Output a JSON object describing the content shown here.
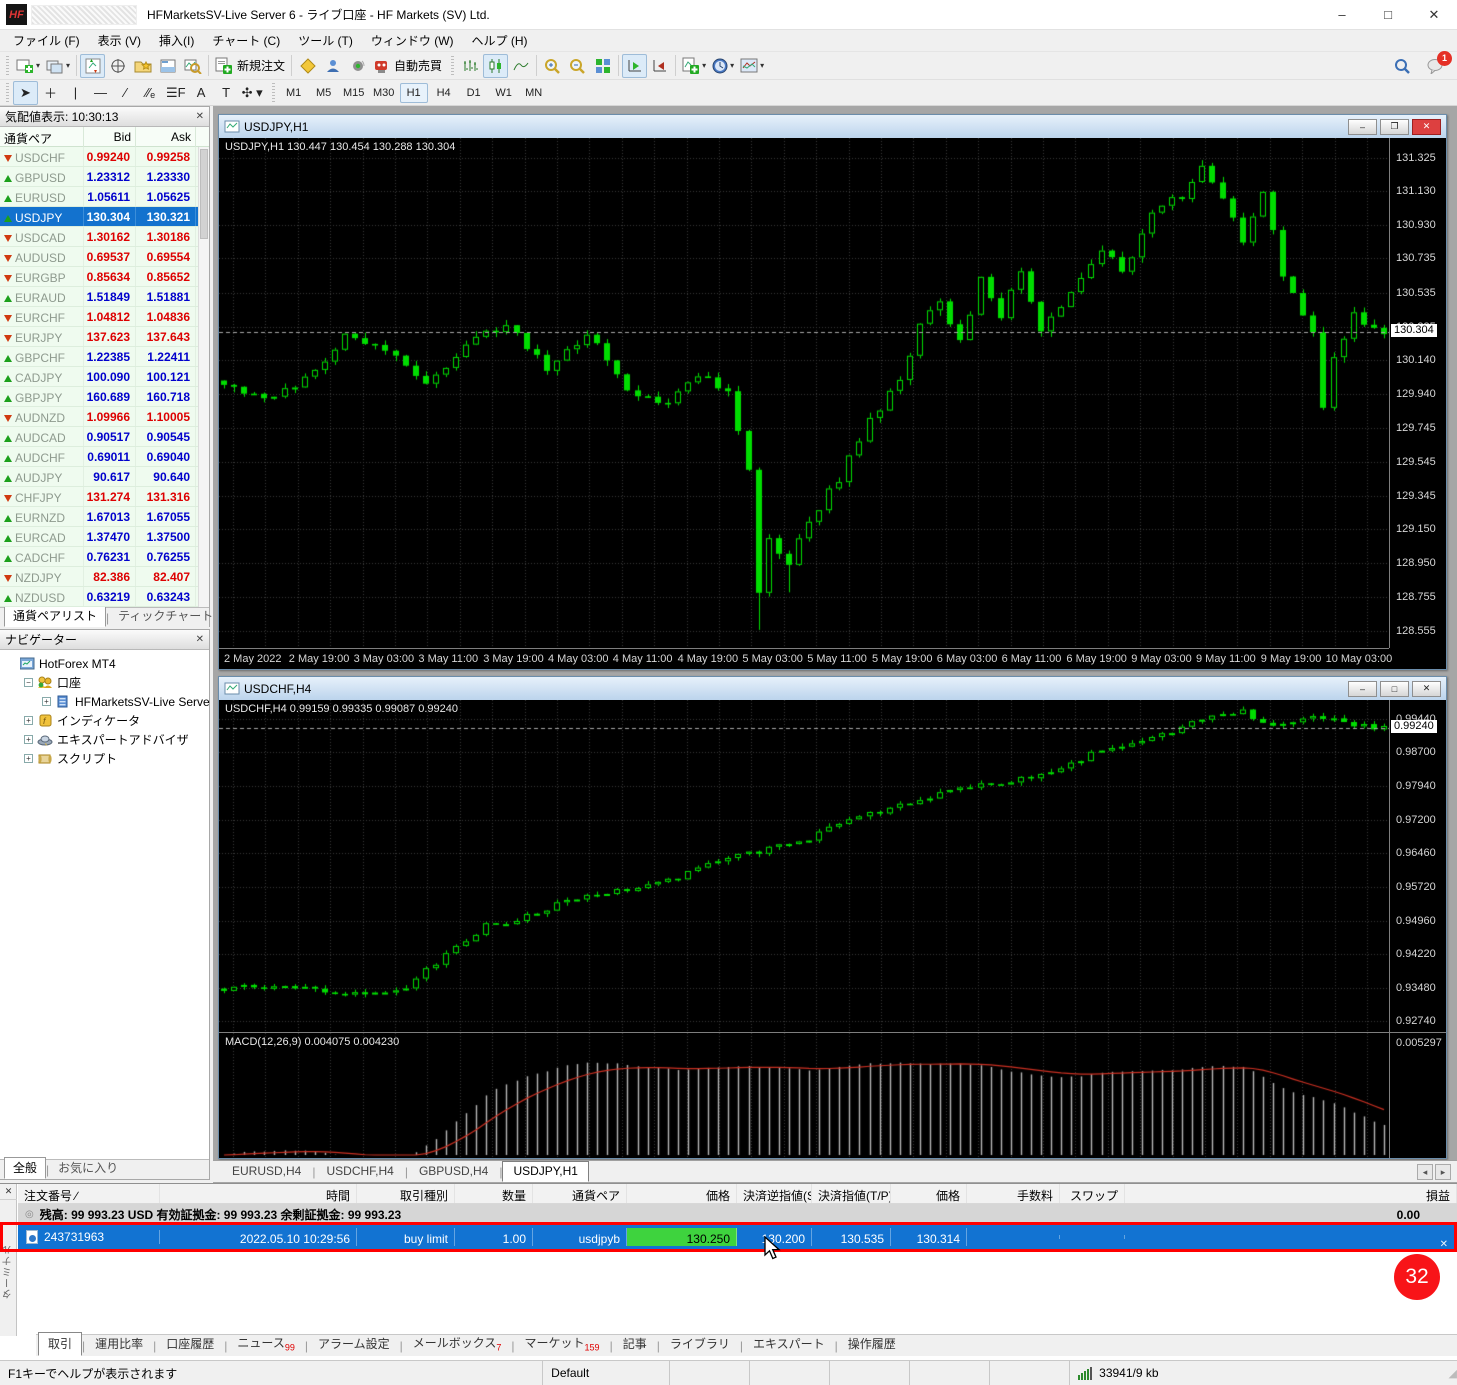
{
  "window": {
    "title": "HFMarketsSV-Live Server 6 - ライブ口座 - HF Markets (SV) Ltd.",
    "logo": "HF",
    "controls": {
      "minimize": "–",
      "maximize": "□",
      "close": "✕"
    }
  },
  "menu": [
    "ファイル (F)",
    "表示 (V)",
    "挿入(I)",
    "チャート (C)",
    "ツール (T)",
    "ウィンドウ (W)",
    "ヘルプ (H)"
  ],
  "toolbar": {
    "new_order_label": "新規注文",
    "auto_trading_label": "自動売買",
    "notification_count": "1",
    "tools": [
      {
        "name": "cursor-tool",
        "glyph": "➤",
        "pressed": true
      },
      {
        "name": "crosshair-tool",
        "glyph": "＋",
        "pressed": false
      },
      {
        "name": "vertical-line-tool",
        "glyph": "|",
        "pressed": false
      },
      {
        "name": "horizontal-line-tool",
        "glyph": "—",
        "pressed": false
      },
      {
        "name": "trendline-tool",
        "glyph": "∕",
        "pressed": false
      },
      {
        "name": "channel-tool",
        "glyph": "∕∕ₑ",
        "pressed": false
      },
      {
        "name": "fibonacci-tool",
        "glyph": "☰F",
        "pressed": false
      },
      {
        "name": "text-tool",
        "glyph": "A",
        "pressed": false
      },
      {
        "name": "text-label-tool",
        "glyph": "T",
        "pressed": false
      },
      {
        "name": "arrows-tool",
        "glyph": "✣ ▾",
        "pressed": false
      }
    ],
    "timeframes": [
      "M1",
      "M5",
      "M15",
      "M30",
      "H1",
      "H4",
      "D1",
      "W1",
      "MN"
    ],
    "active_timeframe": "H1"
  },
  "market_watch": {
    "title": "気配値表示: 10:30:13",
    "columns": [
      "通貨ペア",
      "Bid",
      "Ask"
    ],
    "selected_symbol": "USDJPY",
    "rows": [
      {
        "symbol": "USDCHF",
        "bid": "0.99240",
        "ask": "0.99258",
        "trend": "down"
      },
      {
        "symbol": "GBPUSD",
        "bid": "1.23312",
        "ask": "1.23330",
        "trend": "up"
      },
      {
        "symbol": "EURUSD",
        "bid": "1.05611",
        "ask": "1.05625",
        "trend": "up"
      },
      {
        "symbol": "USDJPY",
        "bid": "130.304",
        "ask": "130.321",
        "trend": "up"
      },
      {
        "symbol": "USDCAD",
        "bid": "1.30162",
        "ask": "1.30186",
        "trend": "down"
      },
      {
        "symbol": "AUDUSD",
        "bid": "0.69537",
        "ask": "0.69554",
        "trend": "down"
      },
      {
        "symbol": "EURGBP",
        "bid": "0.85634",
        "ask": "0.85652",
        "trend": "down"
      },
      {
        "symbol": "EURAUD",
        "bid": "1.51849",
        "ask": "1.51881",
        "trend": "up"
      },
      {
        "symbol": "EURCHF",
        "bid": "1.04812",
        "ask": "1.04836",
        "trend": "down"
      },
      {
        "symbol": "EURJPY",
        "bid": "137.623",
        "ask": "137.643",
        "trend": "down"
      },
      {
        "symbol": "GBPCHF",
        "bid": "1.22385",
        "ask": "1.22411",
        "trend": "up"
      },
      {
        "symbol": "CADJPY",
        "bid": "100.090",
        "ask": "100.121",
        "trend": "up"
      },
      {
        "symbol": "GBPJPY",
        "bid": "160.689",
        "ask": "160.718",
        "trend": "up"
      },
      {
        "symbol": "AUDNZD",
        "bid": "1.09966",
        "ask": "1.10005",
        "trend": "down"
      },
      {
        "symbol": "AUDCAD",
        "bid": "0.90517",
        "ask": "0.90545",
        "trend": "up"
      },
      {
        "symbol": "AUDCHF",
        "bid": "0.69011",
        "ask": "0.69040",
        "trend": "up"
      },
      {
        "symbol": "AUDJPY",
        "bid": "90.617",
        "ask": "90.640",
        "trend": "up"
      },
      {
        "symbol": "CHFJPY",
        "bid": "131.274",
        "ask": "131.316",
        "trend": "down"
      },
      {
        "symbol": "EURNZD",
        "bid": "1.67013",
        "ask": "1.67055",
        "trend": "up"
      },
      {
        "symbol": "EURCAD",
        "bid": "1.37470",
        "ask": "1.37500",
        "trend": "up"
      },
      {
        "symbol": "CADCHF",
        "bid": "0.76231",
        "ask": "0.76255",
        "trend": "up"
      },
      {
        "symbol": "NZDJPY",
        "bid": "82.386",
        "ask": "82.407",
        "trend": "down"
      },
      {
        "symbol": "NZDUSD",
        "bid": "0.63219",
        "ask": "0.63243",
        "trend": "up"
      }
    ],
    "tabs": [
      {
        "label": "通貨ペアリスト",
        "active": true
      },
      {
        "label": "ティックチャート",
        "active": false
      }
    ]
  },
  "navigator": {
    "title": "ナビゲーター",
    "tree": [
      {
        "label": "HotForex MT4",
        "depth": 0,
        "icon": "platform",
        "expander": ""
      },
      {
        "label": "口座",
        "depth": 1,
        "icon": "accounts",
        "expander": "minus"
      },
      {
        "label": "HFMarketsSV-Live Serve",
        "depth": 2,
        "icon": "server",
        "expander": "plus"
      },
      {
        "label": "インディケータ",
        "depth": 1,
        "icon": "indicators",
        "expander": "plus"
      },
      {
        "label": "エキスパートアドバイザ",
        "depth": 1,
        "icon": "experts",
        "expander": "plus"
      },
      {
        "label": "スクリプト",
        "depth": 1,
        "icon": "scripts",
        "expander": "plus"
      }
    ],
    "tabs": [
      {
        "label": "全般",
        "active": true
      },
      {
        "label": "お気に入り",
        "active": false
      }
    ]
  },
  "charts": [
    {
      "symbol_period": "USDJPY,H1",
      "info": "USDJPY,H1  130.447 130.454 130.288 130.304",
      "current_price": "130.304",
      "price_ticks": [
        "131.325",
        "131.130",
        "130.930",
        "130.735",
        "130.535",
        "130.335",
        "130.140",
        "129.940",
        "129.745",
        "129.545",
        "129.345",
        "129.150",
        "128.950",
        "128.755",
        "128.555"
      ],
      "time_labels": [
        "2 May 2022",
        "2 May 19:00",
        "3 May 03:00",
        "3 May 11:00",
        "3 May 19:00",
        "4 May 03:00",
        "4 May 11:00",
        "4 May 19:00",
        "5 May 03:00",
        "5 May 11:00",
        "5 May 19:00",
        "6 May 03:00",
        "6 May 11:00",
        "6 May 19:00",
        "9 May 03:00",
        "9 May 11:00",
        "9 May 19:00",
        "10 May 03:00"
      ],
      "ylim": [
        131.44,
        128.46
      ],
      "candles": 116,
      "seed": 7,
      "vol": 0.055,
      "anchors": [
        [
          0,
          130.02
        ],
        [
          4,
          129.9
        ],
        [
          8,
          130.02
        ],
        [
          12,
          130.28
        ],
        [
          16,
          130.2
        ],
        [
          20,
          129.98
        ],
        [
          24,
          130.25
        ],
        [
          28,
          130.33
        ],
        [
          32,
          130.1
        ],
        [
          36,
          130.3
        ],
        [
          40,
          129.95
        ],
        [
          44,
          129.88
        ],
        [
          47,
          130.05
        ],
        [
          50,
          129.95
        ],
        [
          52,
          129.5
        ],
        [
          53,
          128.8
        ],
        [
          54,
          129.1
        ],
        [
          56,
          128.95
        ],
        [
          58,
          129.2
        ],
        [
          61,
          129.45
        ],
        [
          64,
          129.8
        ],
        [
          67,
          130.0
        ],
        [
          69,
          130.35
        ],
        [
          71,
          130.5
        ],
        [
          73,
          130.25
        ],
        [
          75,
          130.6
        ],
        [
          77,
          130.4
        ],
        [
          79,
          130.65
        ],
        [
          81,
          130.3
        ],
        [
          84,
          130.55
        ],
        [
          87,
          130.8
        ],
        [
          89,
          130.65
        ],
        [
          92,
          131.0
        ],
        [
          95,
          131.1
        ],
        [
          97,
          131.28
        ],
        [
          99,
          131.1
        ],
        [
          101,
          130.85
        ],
        [
          103,
          131.15
        ],
        [
          105,
          130.65
        ],
        [
          107,
          130.4
        ],
        [
          108,
          130.3
        ],
        [
          109,
          129.85
        ],
        [
          110,
          130.15
        ],
        [
          112,
          130.4
        ],
        [
          114,
          130.32
        ],
        [
          115,
          130.3
        ]
      ],
      "wick_lows": [
        [
          53,
          128.56
        ],
        [
          56,
          128.78
        ]
      ]
    },
    {
      "symbol_period": "USDCHF,H4",
      "info": "USDCHF,H4  0.99159 0.99335 0.99087 0.99240",
      "current_price": "0.99240",
      "price_ticks": [
        "0.99440",
        "0.98700",
        "0.97940",
        "0.97200",
        "0.96460",
        "0.95720",
        "0.94960",
        "0.94220",
        "0.93480",
        "0.92740"
      ],
      "time_labels": [],
      "ylim": [
        0.9985,
        0.925
      ],
      "candles": 116,
      "seed": 11,
      "vol": 0.0013,
      "anchors": [
        [
          0,
          0.9346
        ],
        [
          6,
          0.9352
        ],
        [
          10,
          0.9338
        ],
        [
          14,
          0.9332
        ],
        [
          18,
          0.9352
        ],
        [
          22,
          0.942
        ],
        [
          26,
          0.9485
        ],
        [
          30,
          0.9505
        ],
        [
          34,
          0.954
        ],
        [
          38,
          0.9555
        ],
        [
          42,
          0.9575
        ],
        [
          46,
          0.96
        ],
        [
          50,
          0.9635
        ],
        [
          54,
          0.9655
        ],
        [
          58,
          0.968
        ],
        [
          62,
          0.972
        ],
        [
          66,
          0.9745
        ],
        [
          70,
          0.977
        ],
        [
          74,
          0.979
        ],
        [
          78,
          0.9808
        ],
        [
          82,
          0.9825
        ],
        [
          86,
          0.9865
        ],
        [
          90,
          0.9895
        ],
        [
          94,
          0.9915
        ],
        [
          98,
          0.995
        ],
        [
          101,
          0.9958
        ],
        [
          104,
          0.993
        ],
        [
          107,
          0.9948
        ],
        [
          110,
          0.9938
        ],
        [
          113,
          0.9928
        ],
        [
          115,
          0.9924
        ]
      ],
      "wick_lows": [],
      "macd": {
        "label": "MACD(12,26,9) 0.004075 0.004230",
        "axis_max": "0.005297"
      }
    }
  ],
  "chart_tabs": [
    {
      "label": "EURUSD,H4",
      "active": false
    },
    {
      "label": "USDCHF,H4",
      "active": false
    },
    {
      "label": "GBPUSD,H4",
      "active": false
    },
    {
      "label": "USDJPY,H1",
      "active": true
    }
  ],
  "terminal": {
    "columns": [
      "注文番号 ∕",
      "時間",
      "取引種別",
      "数量",
      "通貨ペア",
      "価格",
      "決済逆指値(S/L)",
      "決済指値(T/P)",
      "価格",
      "手数料",
      "スワップ",
      "損益"
    ],
    "balance_line": "残高: 99 993.23 USD  有効証拠金: 99 993.23  余剰証拠金: 99 993.23",
    "balance_profit": "0.00",
    "order": {
      "ticket": "243731963",
      "time": "2022.05.10 10:29:56",
      "type": "buy limit",
      "volume": "1.00",
      "symbol": "usdjpyb",
      "price_open": "130.250",
      "sl": "130.200",
      "tp": "130.535",
      "price_current": "130.314",
      "commission": "",
      "swap": "",
      "profit": ""
    },
    "tabs": [
      {
        "label": "取引",
        "badge": "",
        "active": true
      },
      {
        "label": "運用比率",
        "badge": "",
        "active": false
      },
      {
        "label": "口座履歴",
        "badge": "",
        "active": false
      },
      {
        "label": "ニュース",
        "badge": "99",
        "active": false
      },
      {
        "label": "アラーム設定",
        "badge": "",
        "active": false
      },
      {
        "label": "メールボックス",
        "badge": "7",
        "active": false
      },
      {
        "label": "マーケット",
        "badge": "159",
        "active": false
      },
      {
        "label": "記事",
        "badge": "",
        "active": false
      },
      {
        "label": "ライブラリ",
        "badge": "",
        "active": false
      },
      {
        "label": "エキスパート",
        "badge": "",
        "active": false
      },
      {
        "label": "操作履歴",
        "badge": "",
        "active": false
      }
    ]
  },
  "status_bar": {
    "help_text": "F1キーでヘルプが表示されます",
    "profile": "Default",
    "empty_cells": 5,
    "network": "33941/9 kb"
  },
  "annotations": {
    "step_number": "32"
  },
  "colors": {
    "candle": "#00dd00",
    "grid": "#3a3a3a",
    "chart_bg": "#000000",
    "axis_text": "#d6d6d6",
    "value_up": "#0000cc",
    "value_down": "#dd0000",
    "selected_row": "#1372ce",
    "order_row": "#1273d2",
    "price_cell_green": "#3ed33e",
    "macd_signal": "#cc3022",
    "macd_hist": "#b8b8b8",
    "annotation_red": "#ff0000"
  }
}
